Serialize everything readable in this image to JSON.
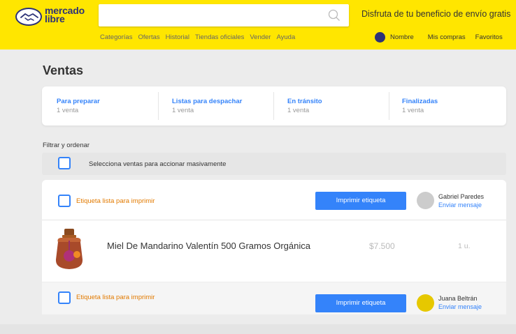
{
  "header": {
    "logo_line1": "mercado",
    "logo_line2": "libre",
    "search_placeholder": "",
    "promo": "Disfruta de tu beneficio de envío gratis",
    "nav": [
      "Categorías",
      "Ofertas",
      "Historial",
      "Tiendas oficiales",
      "Vender",
      "Ayuda"
    ],
    "user_name": "Nombre",
    "my_purchases": "Mis compras",
    "favorites": "Favoritos"
  },
  "page_title": "Ventas",
  "tabs": [
    {
      "label": "Para preparar",
      "count": "1 venta"
    },
    {
      "label": "Listas para despachar",
      "count": "1 venta"
    },
    {
      "label": "En tránsito",
      "count": "1 venta"
    },
    {
      "label": "Finalizadas",
      "count": "1 venta"
    }
  ],
  "filter_label": "Filtrar y ordenar",
  "bulk_select": "Selecciona ventas para accionar masivamente",
  "sales": [
    {
      "status": "Etiqueta lista para imprimir",
      "print_label": "Imprimir etiqueta",
      "buyer": "Gabriel Paredes",
      "message": "Enviar mensaje",
      "avatar_color": "#cccccc",
      "product": "Miel De Mandarino Valentín 500 Gramos Orgánica",
      "price": "$7.500",
      "qty": "1 u."
    },
    {
      "status": "Etiqueta lista para imprimir",
      "print_label": "Imprimir etiqueta",
      "buyer": "Juana Beltrán",
      "message": "Enviar mensaje",
      "avatar_color": "#e6c800"
    }
  ],
  "colors": {
    "brand_yellow": "#ffe600",
    "brand_navy": "#2d3277",
    "accent_blue": "#3483fa",
    "status_orange": "#e27a00"
  }
}
